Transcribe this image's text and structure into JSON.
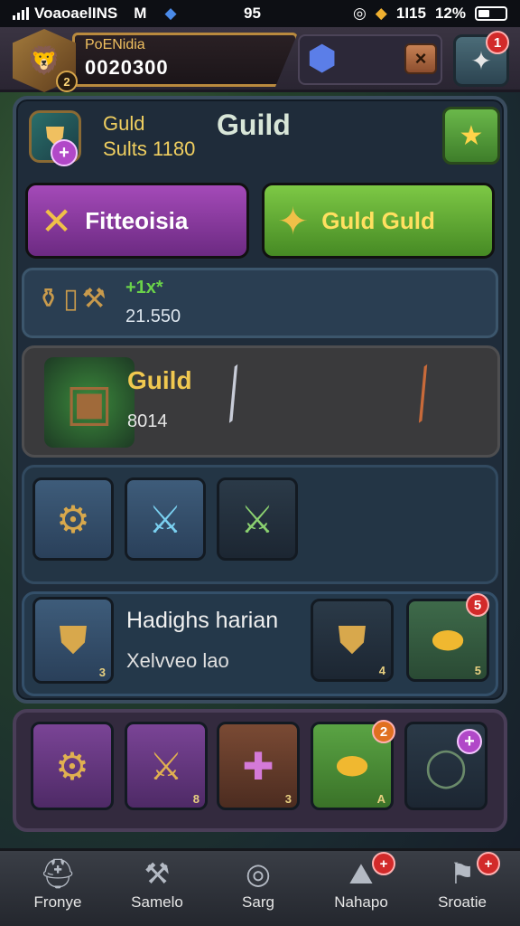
{
  "status_bar": {
    "carrier": "VoaoaelINS",
    "carrier_suffix": "M",
    "time": "95",
    "network": "1I15",
    "battery": "12%"
  },
  "top_bar": {
    "player_name": "PoENidia",
    "player_score": "0020300",
    "avatar_level": "2",
    "close_label": "×",
    "menu_notification": "1"
  },
  "guild": {
    "label": "Guld",
    "suits_text": "Sults 1180",
    "title": "Guild"
  },
  "actions": {
    "purple_button": "Fitteoisia",
    "green_button": "Guld Guld"
  },
  "stats": {
    "sparkle_text": "+1x*",
    "value": "21.550"
  },
  "featured": {
    "title": "Guild",
    "count": "8014"
  },
  "equipment_slots": [
    {
      "name": "scroll-slot",
      "icon": "scroll-icon"
    },
    {
      "name": "blade-slot",
      "icon": "blade-icon"
    },
    {
      "name": "crossed-swords-slot",
      "icon": "crossed-swords-icon"
    }
  ],
  "detail": {
    "title": "Hadighs harian",
    "subtitle": "Xelvveo lao",
    "item_count": "3",
    "shield_num": "4",
    "gold_num": "5",
    "gold_badge": "5"
  },
  "inventory_items": [
    {
      "name": "inv-scroll",
      "num": ""
    },
    {
      "name": "inv-blade",
      "num": "8"
    },
    {
      "name": "inv-wand",
      "num": "3"
    },
    {
      "name": "inv-gold",
      "num": "A",
      "badge": "2"
    },
    {
      "name": "inv-ring",
      "num": "",
      "badge": "+"
    }
  ],
  "bottom_nav": [
    {
      "label": "Fronye",
      "icon": "helmet-icon"
    },
    {
      "label": "Samelo",
      "icon": "anvil-icon"
    },
    {
      "label": "Sarg",
      "icon": "target-icon"
    },
    {
      "label": "Nahapo",
      "icon": "map-icon"
    },
    {
      "label": "Sroatie",
      "icon": "flag-icon"
    }
  ],
  "colors": {
    "accent_gold": "#f0c850",
    "purple_button": "#a44ab8",
    "green_button": "#7dc845",
    "panel": "#1f2c3a",
    "notification_red": "#d22a2a"
  }
}
